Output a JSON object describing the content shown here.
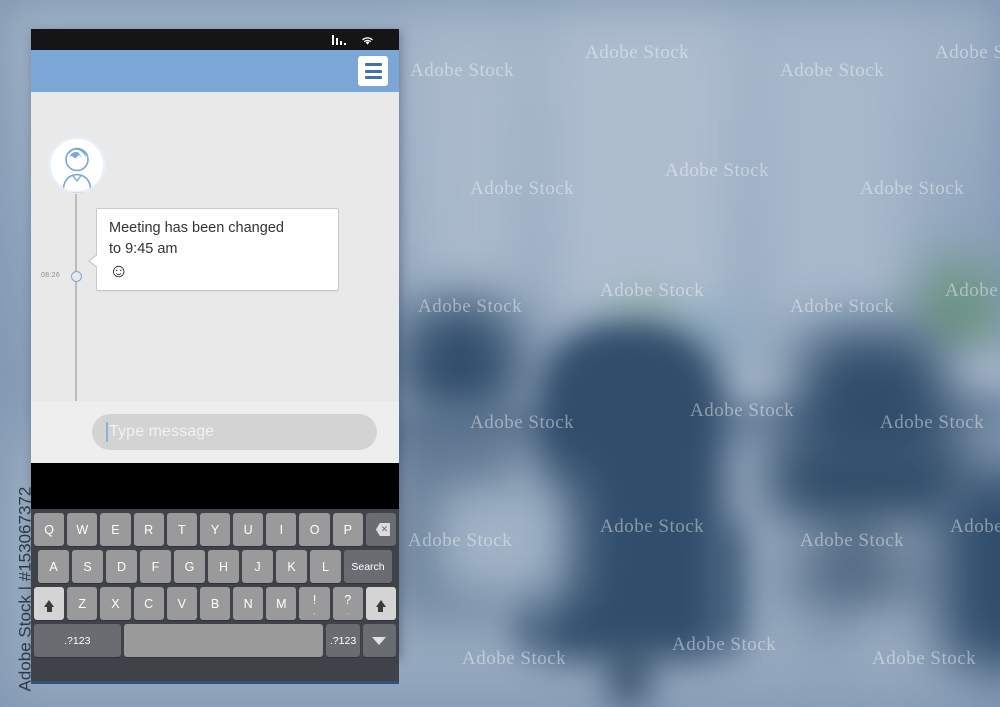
{
  "watermark": {
    "left_strip": "Adobe Stock | #153067372",
    "tile_text": "Adobe Stock"
  },
  "phone": {
    "statusbar": {
      "signal_icon": "signal-bars-icon",
      "wifi_icon": "wifi-icon"
    },
    "appbar": {
      "menu_icon": "hamburger-menu-icon",
      "bar_color": "#7ba7d7"
    },
    "chat": {
      "avatar_icon": "user-avatar-icon",
      "messages": [
        {
          "time": "08:26",
          "text_line1": "Meeting has been changed",
          "text_line2": "to 9:45 am",
          "emoji": "☺"
        }
      ]
    },
    "input": {
      "placeholder": "Type message",
      "value": ""
    },
    "keyboard": {
      "rows": [
        {
          "keys": [
            {
              "label": "Q",
              "type": "letter"
            },
            {
              "label": "W",
              "type": "letter"
            },
            {
              "label": "E",
              "type": "letter"
            },
            {
              "label": "R",
              "type": "letter"
            },
            {
              "label": "T",
              "type": "letter"
            },
            {
              "label": "Y",
              "type": "letter"
            },
            {
              "label": "U",
              "type": "letter"
            },
            {
              "label": "I",
              "type": "letter"
            },
            {
              "label": "O",
              "type": "letter"
            },
            {
              "label": "P",
              "type": "letter"
            },
            {
              "label": "",
              "type": "backspace",
              "icon": "backspace-icon"
            }
          ]
        },
        {
          "keys": [
            {
              "label": "A",
              "type": "letter"
            },
            {
              "label": "S",
              "type": "letter"
            },
            {
              "label": "D",
              "type": "letter"
            },
            {
              "label": "F",
              "type": "letter"
            },
            {
              "label": "G",
              "type": "letter"
            },
            {
              "label": "H",
              "type": "letter"
            },
            {
              "label": "J",
              "type": "letter"
            },
            {
              "label": "K",
              "type": "letter"
            },
            {
              "label": "L",
              "type": "letter"
            },
            {
              "label": "Search",
              "type": "action"
            }
          ]
        },
        {
          "keys": [
            {
              "label": "",
              "type": "shift",
              "icon": "shift-up-icon"
            },
            {
              "label": "Z",
              "type": "letter"
            },
            {
              "label": "X",
              "type": "letter"
            },
            {
              "label": "C",
              "type": "letter"
            },
            {
              "label": "V",
              "type": "letter"
            },
            {
              "label": "B",
              "type": "letter"
            },
            {
              "label": "N",
              "type": "letter"
            },
            {
              "label": "M",
              "type": "letter"
            },
            {
              "label": "!",
              "sub": ",",
              "type": "punct"
            },
            {
              "label": "?",
              "sub": ".",
              "type": "punct"
            },
            {
              "label": "",
              "type": "shift",
              "icon": "shift-up-icon"
            }
          ]
        },
        {
          "keys": [
            {
              "label": ".?123",
              "type": "symbols"
            },
            {
              "label": "",
              "type": "space"
            },
            {
              "label": ".?123",
              "type": "symbols"
            },
            {
              "label": "",
              "type": "hide",
              "icon": "chevron-down-icon"
            }
          ]
        }
      ]
    }
  }
}
